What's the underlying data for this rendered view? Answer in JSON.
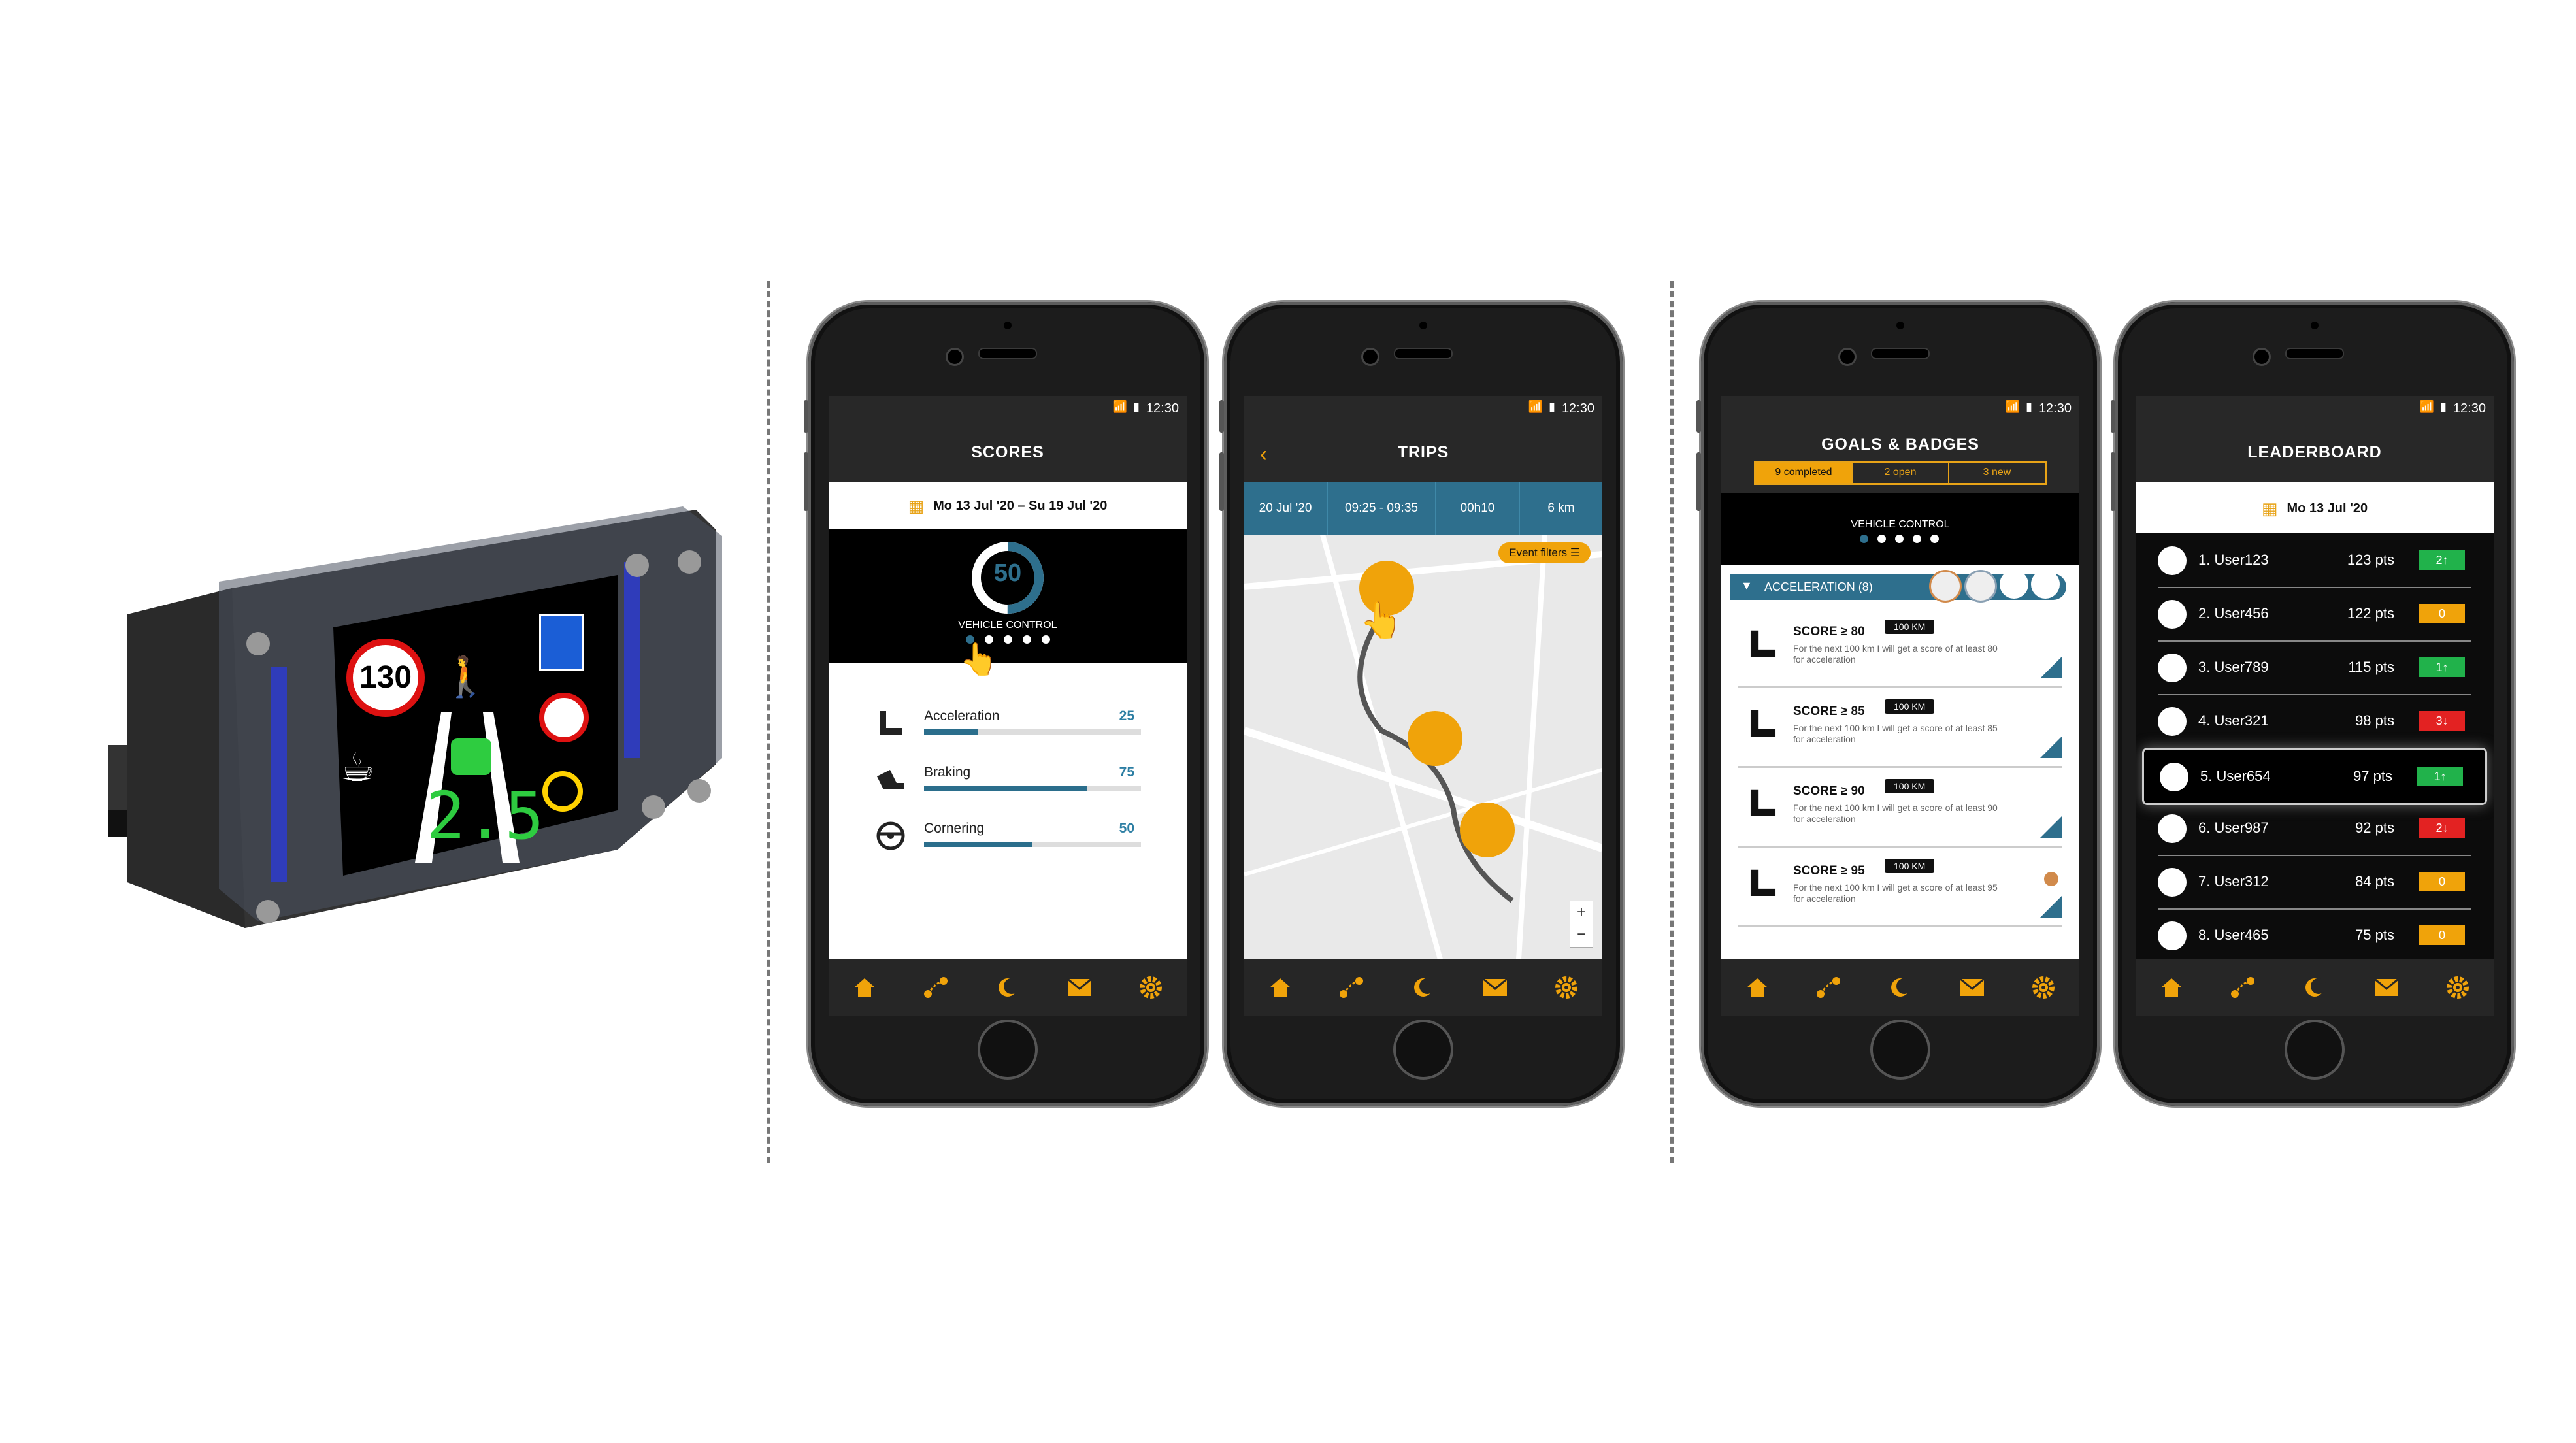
{
  "device": {
    "speed_limit": "130",
    "distance": "2.5"
  },
  "status": {
    "time": "12:30"
  },
  "scores": {
    "title": "SCORES",
    "date_range": "Mo 13 Jul '20 – Su 19 Jul '20",
    "gauge_value": "50",
    "gauge_label": "VEHICLE CONTROL",
    "gauge_fraction": 0.5,
    "metrics": [
      {
        "label": "Acceleration",
        "value": "25",
        "fraction": 0.25
      },
      {
        "label": "Braking",
        "value": "75",
        "fraction": 0.75
      },
      {
        "label": "Cornering",
        "value": "50",
        "fraction": 0.5
      }
    ]
  },
  "trips": {
    "title": "TRIPS",
    "date": "20 Jul '20",
    "time_range": "09:25 - 09:35",
    "duration": "00h10",
    "distance": "6 km",
    "event_filters": "Event filters"
  },
  "goals": {
    "title": "GOALS & BADGES",
    "tabs": [
      "9 completed",
      "2 open",
      "3 new"
    ],
    "section_label": "VEHICLE CONTROL",
    "category": "ACCELERATION (8)",
    "items": [
      {
        "title": "SCORE ≥ 80",
        "badge": "100 KM",
        "desc": "For the next 100 km I will get a score of at least 80 for acceleration"
      },
      {
        "title": "SCORE ≥ 85",
        "badge": "100 KM",
        "desc": "For the next 100 km I will get a score of at least 85 for acceleration"
      },
      {
        "title": "SCORE ≥ 90",
        "badge": "100 KM",
        "desc": "For the next 100 km I will get a score of at least 90 for acceleration"
      },
      {
        "title": "SCORE ≥ 95",
        "badge": "100 KM",
        "desc": "For the next 100 km I will get a score of at least 95 for acceleration"
      }
    ]
  },
  "leaderboard": {
    "title": "LEADERBOARD",
    "date": "Mo 13 Jul '20",
    "rows": [
      {
        "name": "1. User123",
        "pts": "123 pts",
        "rank": "2↑",
        "color": "#21b24b"
      },
      {
        "name": "2. User456",
        "pts": "122 pts",
        "rank": "0",
        "color": "#f0a30a"
      },
      {
        "name": "3. User789",
        "pts": "115 pts",
        "rank": "1↑",
        "color": "#21b24b"
      },
      {
        "name": "4. User321",
        "pts": "98 pts",
        "rank": "3↓",
        "color": "#e32222"
      },
      {
        "name": "5. User654",
        "pts": "97 pts",
        "rank": "1↑",
        "color": "#21b24b"
      },
      {
        "name": "6. User987",
        "pts": "92 pts",
        "rank": "2↓",
        "color": "#e32222"
      },
      {
        "name": "7. User312",
        "pts": "84 pts",
        "rank": "0",
        "color": "#f0a30a"
      },
      {
        "name": "8. User465",
        "pts": "75 pts",
        "rank": "0",
        "color": "#f0a30a"
      }
    ]
  },
  "colors": {
    "accent": "#f0a30a",
    "teal": "#2e6f8d"
  }
}
